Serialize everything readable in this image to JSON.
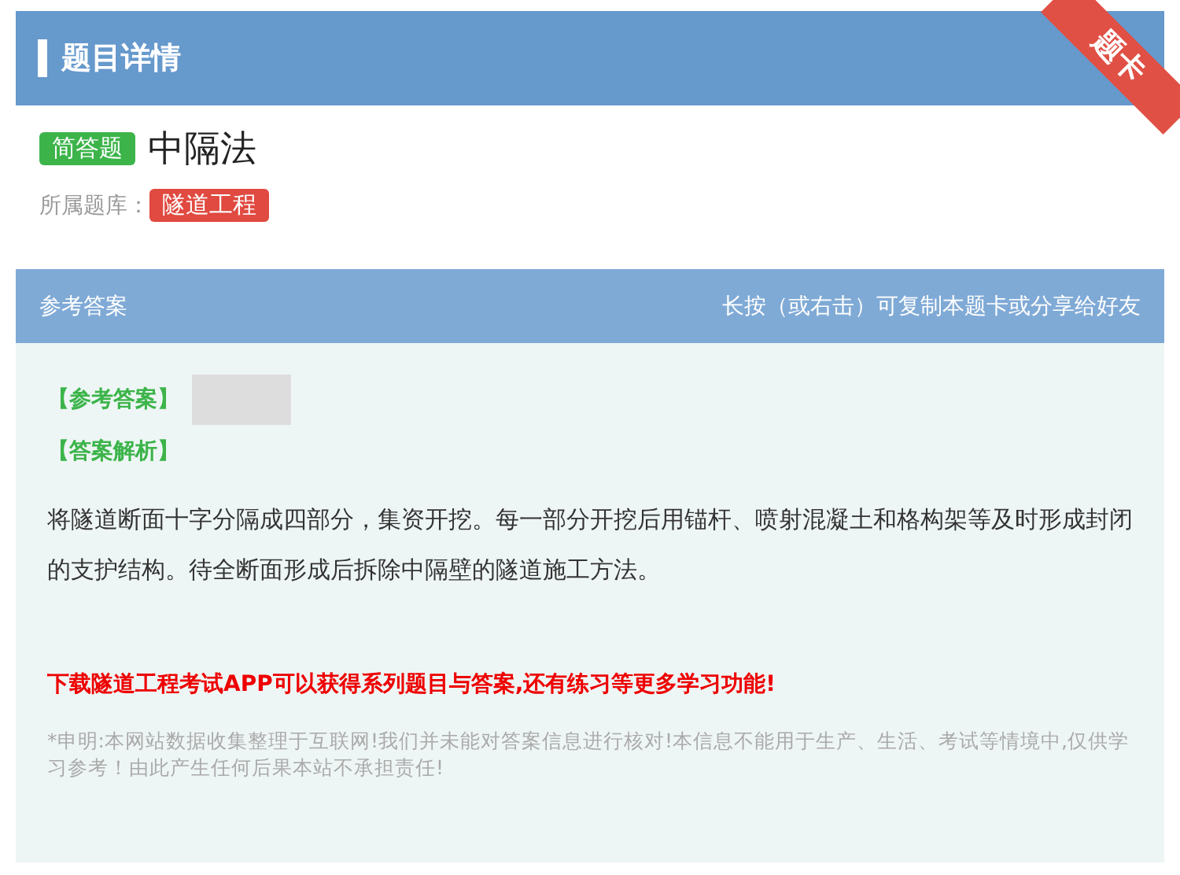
{
  "header": {
    "title": "题目详情",
    "ribbon": "题卡"
  },
  "question": {
    "type_badge": "简答题",
    "title": "中隔法",
    "bank_label": "所属题库：",
    "bank_tag": "隧道工程"
  },
  "answer_panel": {
    "title": "参考答案",
    "hint": "长按（或右击）可复制本题卡或分享给好友",
    "answer_label": "【参考答案】",
    "analysis_label": "【答案解析】",
    "analysis": "将隧道断面十字分隔成四部分，集资开挖。每一部分开挖后用锚杆、喷射混凝土和格构架等及时形成封闭的支护结构。待全断面形成后拆除中隔壁的隧道施工方法。",
    "promo": "下载隧道工程考试APP可以获得系列题目与答案,还有练习等更多学习功能!",
    "disclaimer": "*申明:本网站数据收集整理于互联网!我们并未能对答案信息进行核对!本信息不能用于生产、生活、考试等情境中,仅供学习参考！由此产生任何后果本站不承担责任!"
  }
}
